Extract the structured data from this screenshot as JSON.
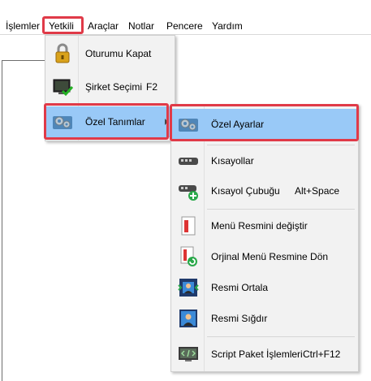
{
  "menubar": {
    "items": [
      "İşlemler",
      "Yetkili",
      "Araçlar",
      "Notlar",
      "Pencere",
      "Yardım"
    ]
  },
  "menu_yetkili": {
    "items": [
      {
        "label": "Oturumu Kapat",
        "icon": "padlock-icon"
      },
      {
        "label": "Şirket Seçimi",
        "shortcut": "F2",
        "icon": "monitor-check-icon"
      },
      {
        "label": "Özel Tanımlar",
        "icon": "settings-gears-icon",
        "has_submenu": true
      }
    ]
  },
  "menu_ozel": {
    "items": [
      {
        "label": "Özel Ayarlar",
        "icon": "settings-gears-icon"
      },
      {
        "label": "Kısayollar",
        "icon": "keyboard-shortcut-icon"
      },
      {
        "label": "Kısayol Çubuğu",
        "shortcut": "Alt+Space",
        "icon": "shortcut-bar-add-icon"
      },
      {
        "label": "Menü Resmini değiştir",
        "icon": "menu-image-icon"
      },
      {
        "label": "Orjinal Menü Resmine Dön",
        "icon": "menu-image-restore-icon"
      },
      {
        "label": "Resmi Ortala",
        "icon": "center-image-icon"
      },
      {
        "label": "Resmi Sığdır",
        "icon": "fit-image-icon"
      },
      {
        "label": "Script Paket İşlemleri",
        "shortcut": "Ctrl+F12",
        "icon": "script-icon"
      }
    ]
  },
  "colors": {
    "highlight": "#99c9f7",
    "annotation_frame": "#e03a48"
  }
}
